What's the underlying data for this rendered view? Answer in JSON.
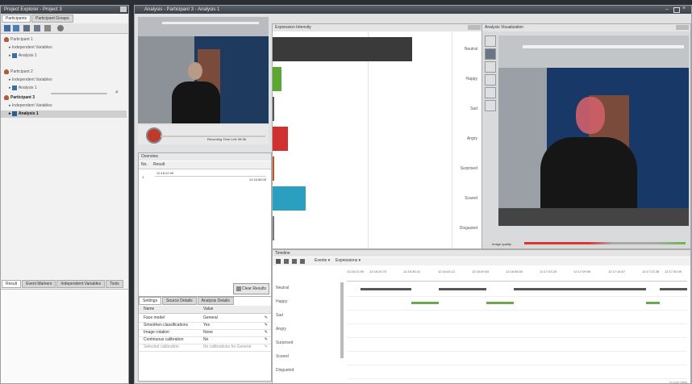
{
  "project_explorer": {
    "title": "Project Explorer - Project 3",
    "tabs": [
      "Participants",
      "Participant Groups"
    ],
    "items": [
      {
        "label": "Participant 1",
        "kind": "participant"
      },
      {
        "label": "Independent Variables",
        "kind": "variables"
      },
      {
        "label": "Analysis 1",
        "kind": "analysis"
      },
      {
        "label": "Participant 2",
        "kind": "participant"
      },
      {
        "label": "Independent Variables",
        "kind": "variables"
      },
      {
        "label": "Analysis 1",
        "kind": "analysis"
      },
      {
        "label": "Participant 3",
        "kind": "participant"
      },
      {
        "label": "Independent Variables",
        "kind": "variables"
      },
      {
        "label": "Analysis 1",
        "kind": "analysis"
      }
    ],
    "bottom_tabs": [
      "Result",
      "Event Markers",
      "Independent Variables",
      "Tools"
    ]
  },
  "analysis": {
    "title": "Analysis - Participant 3 - Analysis 1",
    "recording_text": "Recording Time Left: 08:36"
  },
  "overview": {
    "title": "Overview",
    "columns": [
      "No.",
      "Result"
    ],
    "rows": [
      {
        "no": "1",
        "result": "12:16:22.99",
        "end": "12:16:56.05"
      }
    ],
    "clear_button": "Clear Results"
  },
  "settings": {
    "tabs": [
      "Settings",
      "Source Details",
      "Analysis Details"
    ],
    "columns": [
      "Name",
      "Value"
    ],
    "rows": [
      {
        "name": "Face model",
        "value": "General"
      },
      {
        "name": "Smoothen classifications",
        "value": "Yes"
      },
      {
        "name": "Image rotation",
        "value": "None"
      },
      {
        "name": "Continuous calibration",
        "value": "No"
      },
      {
        "name": "Selected calibration",
        "value": "No calibrations for General"
      }
    ]
  },
  "expression": {
    "title": "Expression Intensity",
    "labels": [
      "Neutral",
      "Happy",
      "Sad",
      "Angry",
      "Surprised",
      "Scared",
      "Disgusted"
    ],
    "values": [
      0.92,
      0.06,
      0.01,
      0.1,
      0.01,
      0.22,
      0.005
    ],
    "colors": [
      "#3a3a3a",
      "#5aa832",
      "#555555",
      "#d13030",
      "#c0552a",
      "#2a9fc0",
      "#777777"
    ]
  },
  "visualization": {
    "title": "Analysis Visualization",
    "quality_label": "Image quality"
  },
  "timeline": {
    "title": "Timeline",
    "menu": [
      "Events",
      "Expressions"
    ],
    "ticks": [
      "12:16:22.99",
      "12:16:29.70",
      "12:16:36.41",
      "12:16:43.12",
      "12:16:49.83",
      "12:16:56.54",
      "12:17:03.25",
      "12:17:09.96",
      "12:17:16.67",
      "12:17:23.38",
      "12:17:30.09"
    ],
    "rows": [
      "Neutral",
      "Happy",
      "Sad",
      "Angry",
      "Surprised",
      "Scared",
      "Disgusted"
    ],
    "segments": [
      {
        "row": 0,
        "start": 0.04,
        "end": 0.19,
        "color": "#555555"
      },
      {
        "row": 0,
        "start": 0.27,
        "end": 0.41,
        "color": "#555555"
      },
      {
        "row": 0,
        "start": 0.49,
        "end": 0.88,
        "color": "#555555"
      },
      {
        "row": 0,
        "start": 0.92,
        "end": 1.0,
        "color": "#555555"
      },
      {
        "row": 1,
        "start": 0.19,
        "end": 0.27,
        "color": "#6aa84f"
      },
      {
        "row": 1,
        "start": 0.41,
        "end": 0.49,
        "color": "#6aa84f"
      },
      {
        "row": 1,
        "start": 0.88,
        "end": 0.92,
        "color": "#6aa84f"
      }
    ],
    "footer": "To Live View"
  }
}
